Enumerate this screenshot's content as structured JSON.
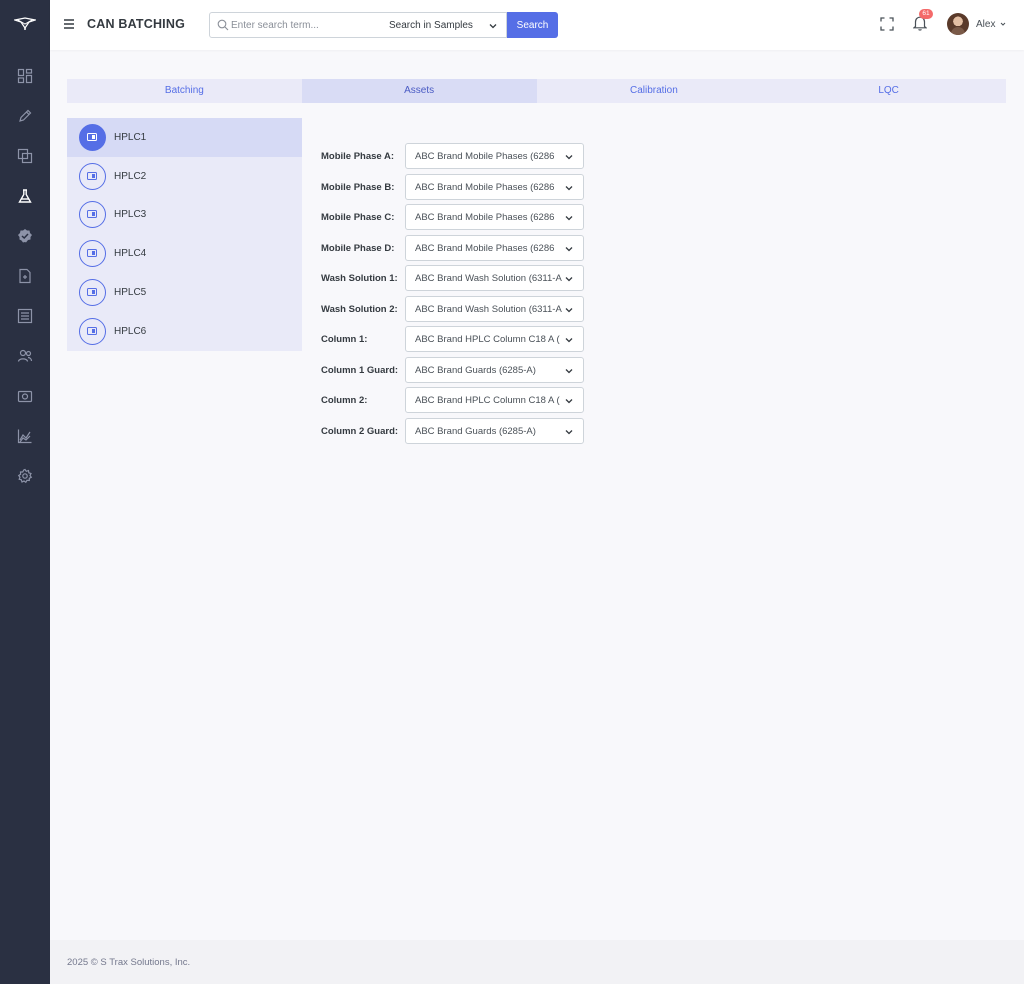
{
  "header": {
    "title": "CAN BATCHING",
    "search_placeholder": "Enter search term...",
    "scope_selected": "Search in Samples",
    "search_button": "Search",
    "notification_count": "61",
    "user_name": "Alex"
  },
  "tabs": [
    {
      "label": "Batching",
      "active": false
    },
    {
      "label": "Assets",
      "active": true
    },
    {
      "label": "Calibration",
      "active": false
    },
    {
      "label": "LQC",
      "active": false
    }
  ],
  "instruments": [
    {
      "label": "HPLC1",
      "active": true
    },
    {
      "label": "HPLC2",
      "active": false
    },
    {
      "label": "HPLC3",
      "active": false
    },
    {
      "label": "HPLC4",
      "active": false
    },
    {
      "label": "HPLC5",
      "active": false
    },
    {
      "label": "HPLC6",
      "active": false
    }
  ],
  "assets": [
    {
      "label": "Mobile Phase A:",
      "value": "ABC Brand Mobile Phases (6286"
    },
    {
      "label": "Mobile Phase B:",
      "value": "ABC Brand Mobile Phases (6286"
    },
    {
      "label": "Mobile Phase C:",
      "value": "ABC Brand Mobile Phases (6286"
    },
    {
      "label": "Mobile Phase D:",
      "value": "ABC Brand Mobile Phases (6286"
    },
    {
      "label": "Wash Solution 1:",
      "value": "ABC Brand Wash Solution (6311-A"
    },
    {
      "label": "Wash Solution 2:",
      "value": "ABC Brand Wash Solution (6311-A"
    },
    {
      "label": "Column 1:",
      "value": "ABC Brand HPLC Column C18 A ("
    },
    {
      "label": "Column 1 Guard:",
      "value": "ABC Brand Guards (6285-A)"
    },
    {
      "label": "Column 2:",
      "value": "ABC Brand HPLC Column C18 A ("
    },
    {
      "label": "Column 2 Guard:",
      "value": "ABC Brand Guards (6285-A)"
    }
  ],
  "footer": {
    "copyright": "2025 © S Trax Solutions, Inc."
  },
  "colors": {
    "accent": "#556ee6",
    "sidebar": "#2a3042",
    "badge": "#f46a6a"
  }
}
